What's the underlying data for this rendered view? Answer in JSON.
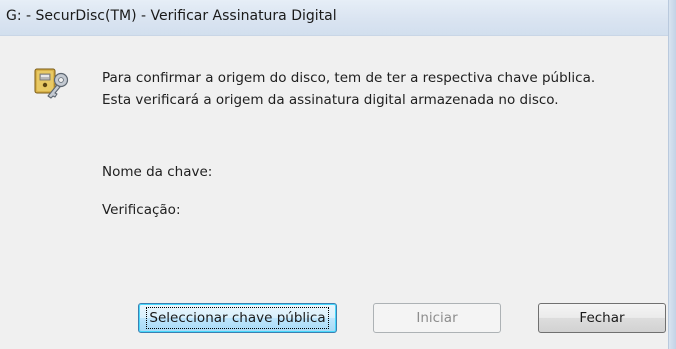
{
  "window": {
    "title": "G: - SecurDisc(TM) - Verificar Assinatura Digital"
  },
  "dialog": {
    "icon": "key-lock-icon",
    "message_line1": "Para confirmar a origem do disco, tem de ter a respectiva chave pública.",
    "message_line2": "Esta verificará a origem da assinatura digital armazenada no disco.",
    "key_name_label": "Nome da chave:",
    "verification_label": "Verificação:"
  },
  "buttons": {
    "select_key": "Seleccionar chave pública",
    "start": "Iniciar",
    "close": "Fechar"
  },
  "colors": {
    "title_bar": "#dae4f1",
    "client_bg": "#f0f0f0",
    "focused_button_border": "#3c7fb1",
    "disabled_text": "#8d8d8d"
  }
}
